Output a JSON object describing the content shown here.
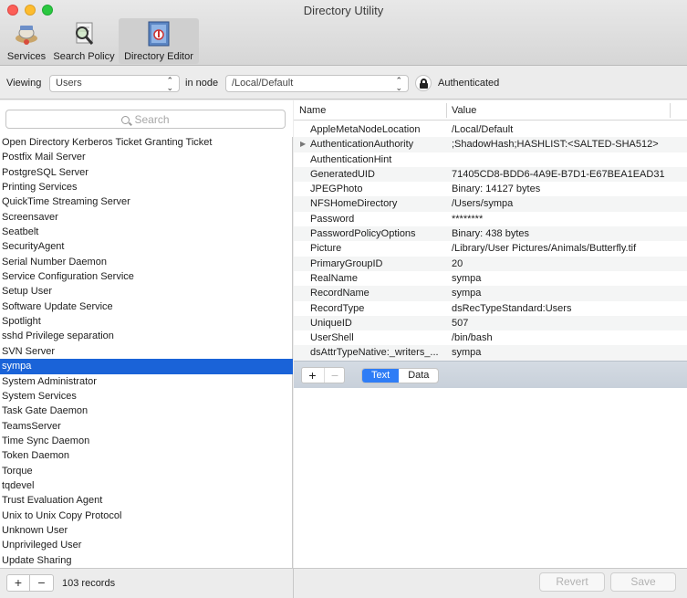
{
  "window": {
    "title": "Directory Utility"
  },
  "toolbar": {
    "services_label": "Services",
    "search_policy_label": "Search Policy",
    "directory_editor_label": "Directory Editor"
  },
  "viewbar": {
    "viewing_label": "Viewing",
    "viewing_value": "Users",
    "in_node_label": "in node",
    "node_value": "/Local/Default",
    "auth_status": "Authenticated"
  },
  "search": {
    "placeholder": "Search"
  },
  "records": {
    "items": [
      "Open Directory Kerberos Ticket Granting Ticket",
      "Postfix Mail Server",
      "PostgreSQL Server",
      "Printing Services",
      "QuickTime Streaming Server",
      "Screensaver",
      "Seatbelt",
      "SecurityAgent",
      "Serial Number Daemon",
      "Service Configuration Service",
      "Setup User",
      "Software Update Service",
      "Spotlight",
      "sshd Privilege separation",
      "SVN Server",
      "sympa",
      "System Administrator",
      "System Services",
      "Task Gate Daemon",
      "TeamsServer",
      "Time Sync Daemon",
      "Token Daemon",
      "Torque",
      "tqdevel",
      "Trust Evaluation Agent",
      "Unix to Unix Copy Protocol",
      "Unknown User",
      "Unprivileged User",
      "Update Sharing"
    ],
    "selected": "sympa",
    "count_label": "103 records"
  },
  "attributes": {
    "col_name": "Name",
    "col_value": "Value",
    "rows": [
      {
        "name": "AppleMetaNodeLocation",
        "value": "/Local/Default"
      },
      {
        "name": "AuthenticationAuthority",
        "value": ";ShadowHash;HASHLIST:<SALTED-SHA512>"
      },
      {
        "name": "AuthenticationHint",
        "value": ""
      },
      {
        "name": "GeneratedUID",
        "value": "71405CD8-BDD6-4A9E-B7D1-E67BEA1EAD31"
      },
      {
        "name": "JPEGPhoto",
        "value": "Binary: 14127 bytes"
      },
      {
        "name": "NFSHomeDirectory",
        "value": "/Users/sympa"
      },
      {
        "name": "Password",
        "value": "********"
      },
      {
        "name": "PasswordPolicyOptions",
        "value": "Binary: 438 bytes"
      },
      {
        "name": "Picture",
        "value": "/Library/User Pictures/Animals/Butterfly.tif"
      },
      {
        "name": "PrimaryGroupID",
        "value": "20"
      },
      {
        "name": "RealName",
        "value": "sympa"
      },
      {
        "name": "RecordName",
        "value": "sympa"
      },
      {
        "name": "RecordType",
        "value": "dsRecTypeStandard:Users"
      },
      {
        "name": "UniqueID",
        "value": "507"
      },
      {
        "name": "UserShell",
        "value": "/bin/bash"
      },
      {
        "name": "dsAttrTypeNative:_writers_...",
        "value": "sympa"
      }
    ],
    "text_tab": "Text",
    "data_tab": "Data"
  },
  "footer": {
    "revert_label": "Revert",
    "save_label": "Save"
  },
  "colors": {
    "selection": "#1a63d8",
    "segment_on": "#2f7df6"
  }
}
